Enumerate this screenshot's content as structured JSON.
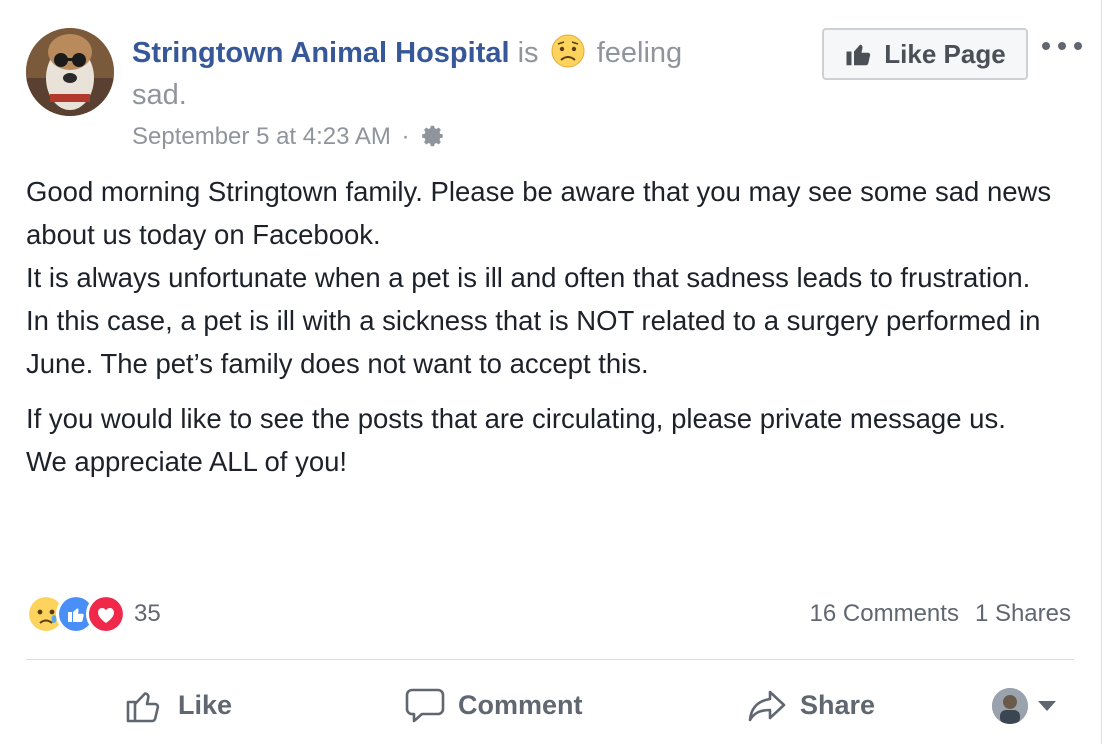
{
  "post": {
    "page_name": "Stringtown Animal Hospital",
    "is_word": "is",
    "feeling_text": "feeling sad.",
    "timestamp": "September 5 at 4:23 AM",
    "meta_separator": "·",
    "like_page_label": "Like Page",
    "body": [
      "Good morning Stringtown family. Please be aware that you may see some sad news about us today on Facebook.",
      "It is always unfortunate when a pet is ill and often that sadness leads to frustration.",
      "In this case, a pet is ill with a sickness that is NOT related to a surgery performed in June. The pet’s family does not want to accept this."
    ],
    "body2": [
      "If you would like to see the posts that are circulating, please private message us.",
      "We appreciate ALL of you!"
    ]
  },
  "reactions": {
    "icons": [
      "sad-reaction-icon",
      "like-reaction-icon",
      "love-reaction-icon"
    ],
    "count": "35",
    "comments": "16 Comments",
    "shares": "1 Shares"
  },
  "actions": {
    "like_label": "Like",
    "comment_label": "Comment",
    "share_label": "Share"
  },
  "colors": {
    "link": "#365899",
    "muted": "#90949c",
    "like_blue": "#4a8ef7",
    "love_red": "#f0284a",
    "sad_yellow": "#fcd35d"
  }
}
